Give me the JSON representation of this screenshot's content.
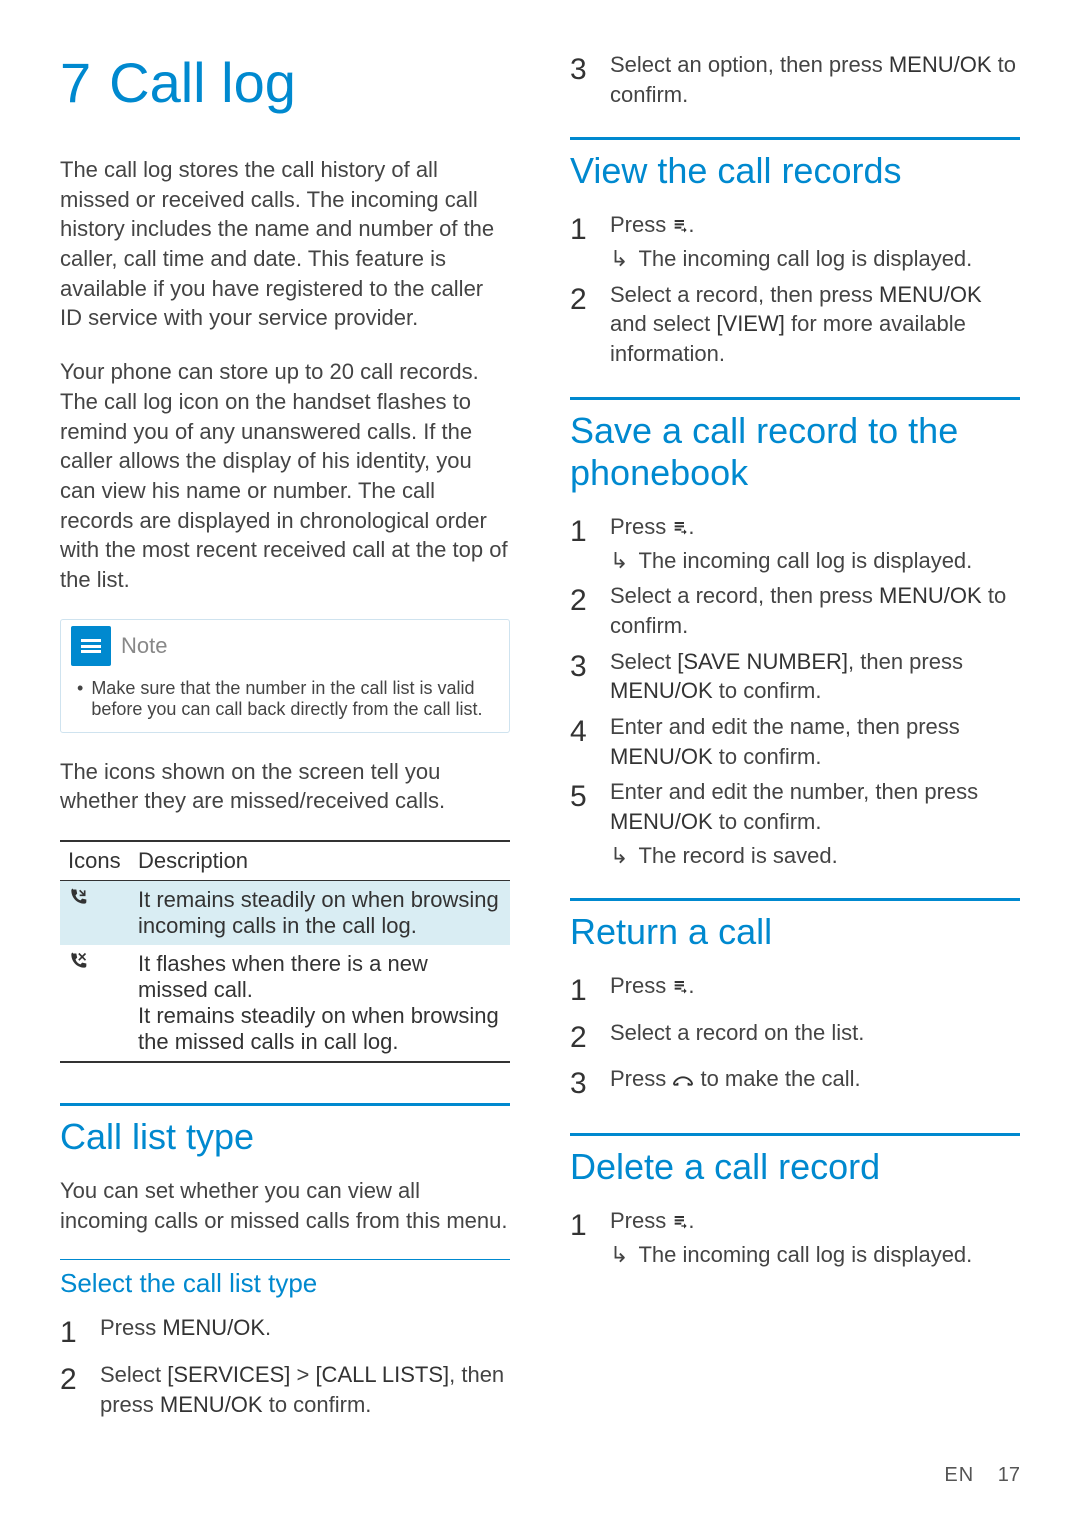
{
  "chapter": {
    "num": "7",
    "title": "Call log"
  },
  "intro": {
    "p1": "The call log stores the call history of all missed or received calls. The incoming call history includes the name and number of the caller, call time and date. This feature is available if you have registered to the caller ID service with your service provider.",
    "p2": "Your phone can store up to 20 call records. The call log icon on the handset flashes to remind you of any unanswered calls. If the caller allows the display of his identity, you can view his name or number. The call records are displayed in chronological order with the most recent received call at the top of the list."
  },
  "note": {
    "label": "Note",
    "bullet": "Make sure that the number in the call list is valid before you can call back directly from the call list."
  },
  "icons_intro": "The icons shown on the screen tell you whether they are missed/received calls.",
  "icon_table": {
    "headers": {
      "icons": "Icons",
      "desc": "Description"
    },
    "rows": [
      {
        "icon_name": "incoming-call-icon",
        "desc": "It remains steadily on when browsing incoming calls in the call log."
      },
      {
        "icon_name": "missed-call-icon",
        "desc_a": "It flashes when there is a new missed call.",
        "desc_b": "It remains steadily on when browsing the missed calls in call log."
      }
    ]
  },
  "call_list_type": {
    "title": "Call list type",
    "intro": "You can set whether you can view all incoming calls or missed calls from this menu.",
    "sub": "Select the call list type",
    "steps": {
      "s1": {
        "pre": "Press ",
        "k1": "MENU/OK",
        "post": "."
      },
      "s2": {
        "pre": "Select ",
        "k1": "[SERVICES]",
        "mid": " > ",
        "k2": "[CALL LISTS]",
        "post": ", then press ",
        "k3": "MENU/OK",
        "tail": " to confirm."
      },
      "s3": {
        "pre": "Select an option, then press ",
        "k1": "MENU/OK",
        "post": " to confirm."
      }
    }
  },
  "view_records": {
    "title": "View the call records",
    "steps": {
      "s1": {
        "pre": "Press ",
        "post": ".",
        "result": "The incoming call log is displayed."
      },
      "s2": {
        "pre": "Select a record, then press ",
        "k1": "MENU/OK",
        "mid": " and select ",
        "k2": "[VIEW]",
        "post": " for more available information."
      }
    }
  },
  "save_record": {
    "title": "Save a call record to the phonebook",
    "steps": {
      "s1": {
        "pre": "Press ",
        "post": ".",
        "result": "The incoming call log is displayed."
      },
      "s2": {
        "pre": "Select a record, then press ",
        "k1": "MENU/OK",
        "post": " to confirm."
      },
      "s3": {
        "pre": "Select ",
        "k1": "[SAVE NUMBER]",
        "mid": ", then press ",
        "k2": "MENU/OK",
        "post": " to confirm."
      },
      "s4": {
        "pre": "Enter and edit the name, then press ",
        "k1": "MENU/OK",
        "post": " to confirm."
      },
      "s5": {
        "pre": "Enter and edit the number, then press ",
        "k1": "MENU/OK",
        "post": " to confirm.",
        "result": "The record is saved."
      }
    }
  },
  "return_call": {
    "title": "Return a call",
    "steps": {
      "s1": {
        "pre": "Press ",
        "post": "."
      },
      "s2": {
        "text": "Select a record on the list."
      },
      "s3": {
        "pre": "Press ",
        "post": " to make the call."
      }
    }
  },
  "delete_record": {
    "title": "Delete a call record",
    "steps": {
      "s1": {
        "pre": "Press ",
        "post": ".",
        "result": "The incoming call log is displayed."
      }
    }
  },
  "footer": {
    "lang": "EN",
    "page": "17"
  }
}
